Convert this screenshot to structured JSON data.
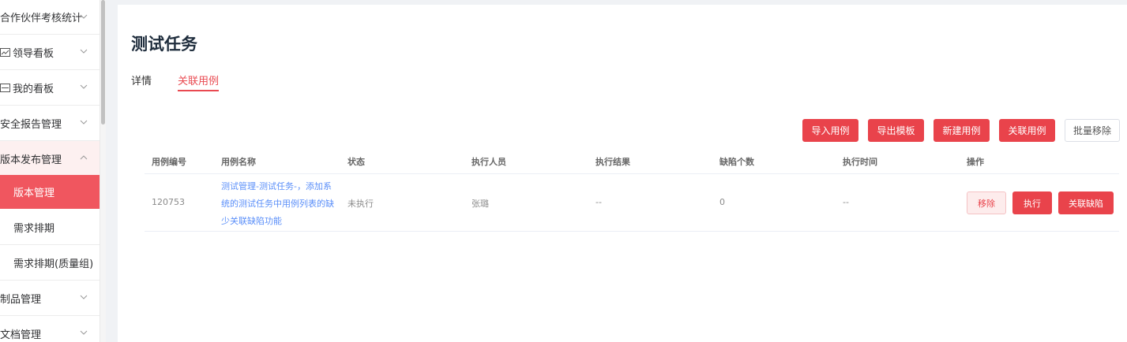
{
  "sidebar": {
    "items": [
      {
        "label": "合作伙伴考核统计",
        "icon": "",
        "state": "collapsed"
      },
      {
        "label": "领导看板",
        "icon": "chart-icon",
        "state": "collapsed"
      },
      {
        "label": "我的看板",
        "icon": "board-icon",
        "state": "collapsed"
      },
      {
        "label": "安全报告管理",
        "icon": "",
        "state": "collapsed"
      },
      {
        "label": "版本发布管理",
        "icon": "",
        "state": "expanded"
      },
      {
        "label": "版本管理",
        "state": "active"
      },
      {
        "label": "需求排期",
        "state": "normal"
      },
      {
        "label": "需求排期(质量组)",
        "state": "normal"
      },
      {
        "label": "制品管理",
        "icon": "",
        "state": "collapsed"
      },
      {
        "label": "文档管理",
        "icon": "",
        "state": "collapsed"
      }
    ]
  },
  "page": {
    "title": "测试任务",
    "tabs": [
      {
        "label": "详情",
        "active": false
      },
      {
        "label": "关联用例",
        "active": true
      }
    ]
  },
  "toolbar": {
    "import_label": "导入用例",
    "export_label": "导出模板",
    "new_label": "新建用例",
    "link_label": "关联用例",
    "batch_remove_label": "批量移除"
  },
  "table": {
    "headers": [
      "用例编号",
      "用例名称",
      "状态",
      "执行人员",
      "执行结果",
      "缺陷个数",
      "执行时间",
      "操作"
    ],
    "rows": [
      {
        "id": "120753",
        "name_lines": [
          "测试管理-测试任务-，添加系",
          "统的测试任务中用例列表的缺",
          "少关联缺陷功能"
        ],
        "status": "未执行",
        "executor": "张璐",
        "result": "--",
        "defects": "0",
        "time": "--",
        "actions": [
          "移除",
          "执行",
          "关联缺陷"
        ]
      }
    ]
  },
  "colors": {
    "accent": "#e9434b",
    "link": "#5b8ff9",
    "active_menu": "#f0565f"
  }
}
